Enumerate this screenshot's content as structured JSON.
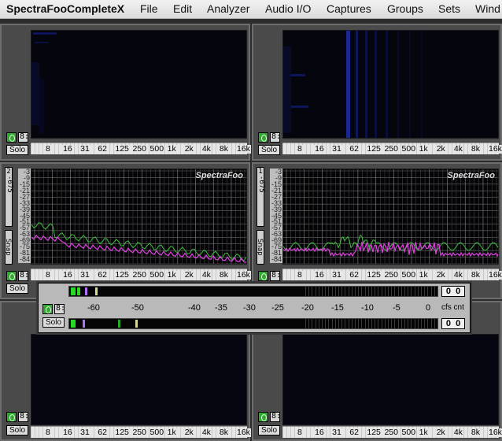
{
  "menubar": {
    "app_name": "SpectraFooCompleteX",
    "items": [
      "File",
      "Edit",
      "Analyzer",
      "Audio I/O",
      "Captures",
      "Groups",
      "Sets",
      "Wind"
    ]
  },
  "freq_ticks": [
    "8",
    "16",
    "31",
    "62",
    "125",
    "250",
    "500",
    "1k",
    "2k",
    "4k",
    "8k",
    "16k"
  ],
  "db_ticks": [
    "-3",
    "-9",
    "-15",
    "-21",
    "-27",
    "-33",
    "-39",
    "-45",
    "-51",
    "-57",
    "-63",
    "-69",
    "-75",
    "-81",
    "-84"
  ],
  "solo_label": "Solo",
  "snap_label": "Snap",
  "brand_logo": "SpectraFoo",
  "left_strip": {
    "channel": "2",
    "value": "-675"
  },
  "right_strip": {
    "channel": "1",
    "value": "-675"
  },
  "level_meter": {
    "scale": [
      "-60",
      "-50",
      "-40",
      "-35",
      "-30",
      "-25",
      "-20",
      "-15",
      "-10",
      "-5",
      "0"
    ],
    "unit_label": "cfs cnt",
    "top_counts": [
      "0",
      "0"
    ],
    "bottom_counts": [
      "0",
      "0"
    ]
  },
  "colors": {
    "trace_magenta": "#e040e0",
    "trace_green": "#3fbf3f",
    "spectrogram_blue": "#1a2a9a",
    "meter_green": "#22dd22",
    "meter_violet": "#b070ff",
    "meter_yellow": "#d8d890"
  }
}
